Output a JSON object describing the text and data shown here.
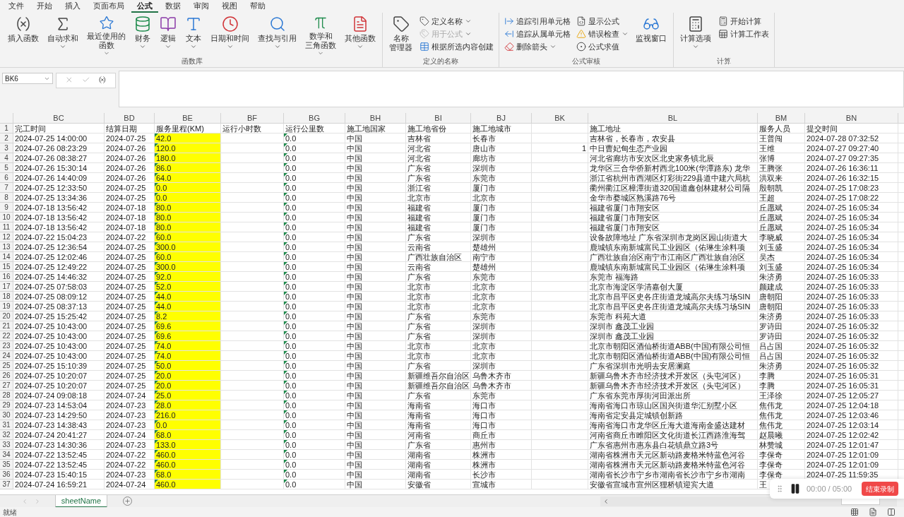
{
  "menu_tabs": [
    {
      "label": "文件",
      "selected": false
    },
    {
      "label": "开始",
      "selected": false
    },
    {
      "label": "插入",
      "selected": false
    },
    {
      "label": "页面布局",
      "selected": false
    },
    {
      "label": "公式",
      "selected": true
    },
    {
      "label": "数据",
      "selected": false
    },
    {
      "label": "审阅",
      "selected": false
    },
    {
      "label": "视图",
      "selected": false
    },
    {
      "label": "帮助",
      "selected": false
    }
  ],
  "ribbon": {
    "groups": [
      {
        "label": "函数库",
        "items": [
          {
            "kind": "large",
            "lines": [
              "插入函数"
            ],
            "dropdown": false
          },
          {
            "kind": "large",
            "lines": [
              "自动求和"
            ],
            "dropdown": true
          },
          {
            "kind": "large",
            "lines": [
              "最近使用的",
              "函数"
            ],
            "dropdown": true
          },
          {
            "kind": "large",
            "lines": [
              "财务"
            ],
            "dropdown": true
          },
          {
            "kind": "large",
            "lines": [
              "逻辑"
            ],
            "dropdown": true
          },
          {
            "kind": "large",
            "lines": [
              "文本"
            ],
            "dropdown": true
          },
          {
            "kind": "large",
            "lines": [
              "日期和时间"
            ],
            "dropdown": true
          },
          {
            "kind": "large",
            "lines": [
              "查找与引用"
            ],
            "dropdown": true
          },
          {
            "kind": "large",
            "lines": [
              "数学和",
              "三角函数"
            ],
            "dropdown": true
          },
          {
            "kind": "large",
            "lines": [
              "其他函数"
            ],
            "dropdown": true
          }
        ]
      },
      {
        "label": "定义的名称",
        "items": [
          {
            "kind": "large",
            "lines": [
              "名称",
              "管理器"
            ],
            "dropdown": false
          },
          {
            "kind": "small",
            "lines": [
              "定义名称"
            ],
            "dropdown": true,
            "disabled": false
          },
          {
            "kind": "small",
            "lines": [
              "用于公式"
            ],
            "dropdown": true,
            "disabled": true
          },
          {
            "kind": "small",
            "lines": [
              "根据所选内容创建"
            ],
            "dropdown": false,
            "disabled": false
          }
        ]
      },
      {
        "label": "公式审核",
        "items": [
          {
            "kind": "small",
            "lines": [
              "追踪引用单元格"
            ],
            "dropdown": false,
            "disabled": false
          },
          {
            "kind": "small",
            "lines": [
              "追踪从属单元格"
            ],
            "dropdown": false,
            "disabled": false
          },
          {
            "kind": "small",
            "lines": [
              "删除箭头"
            ],
            "dropdown": true,
            "disabled": false
          },
          {
            "kind": "small",
            "lines": [
              "显示公式"
            ],
            "dropdown": false,
            "disabled": false
          },
          {
            "kind": "small",
            "lines": [
              "错误检查"
            ],
            "dropdown": true,
            "disabled": false
          },
          {
            "kind": "small",
            "lines": [
              "公式求值"
            ],
            "dropdown": false,
            "disabled": false
          },
          {
            "kind": "large",
            "lines": [
              "监视窗口"
            ],
            "dropdown": false
          }
        ]
      },
      {
        "label": "计算",
        "items": [
          {
            "kind": "large",
            "lines": [
              "计算选项"
            ],
            "dropdown": true
          },
          {
            "kind": "small",
            "lines": [
              "开始计算"
            ],
            "dropdown": false,
            "disabled": false
          },
          {
            "kind": "small",
            "lines": [
              "计算工作表"
            ],
            "dropdown": false,
            "disabled": false
          }
        ]
      }
    ]
  },
  "formula_bar": {
    "name_box": "BK6"
  },
  "columns": [
    {
      "letter": "BC"
    },
    {
      "letter": "BD"
    },
    {
      "letter": "BE",
      "color": "#ffff00",
      "error_flag": true
    },
    {
      "letter": "BF"
    },
    {
      "letter": "BG",
      "error_flag": true
    },
    {
      "letter": "BH"
    },
    {
      "letter": "BI"
    },
    {
      "letter": "BJ"
    },
    {
      "letter": "BK",
      "right_aligned": true
    },
    {
      "letter": "BL"
    },
    {
      "letter": "BM"
    },
    {
      "letter": "BN"
    }
  ],
  "header_row": {
    "num": "1",
    "bc": "完工时间",
    "bd": "结算日期",
    "be": "服务里程(KM)",
    "bf": "运行小时数",
    "bg": "运行公里数",
    "bh": "施工地国家",
    "bi": "施工地省份",
    "bj": "施工地城市",
    "bl": "施工地址",
    "bm": "服务人员",
    "bn": "提交时间"
  },
  "rows": [
    {
      "num": "2",
      "bc": "2024-07-25 14:00:00",
      "bd": "2024-07-25",
      "be": "42.0",
      "bg": "0.0",
      "bh": "中国",
      "bi": "吉林省",
      "bj": "长春市",
      "bl": "吉林省，长春市，农安县",
      "bm": "王普闯",
      "bn": "2024-07-28 07:32:52"
    },
    {
      "num": "3",
      "bc": "2024-07-26 08:23:29",
      "bd": "2024-07-26",
      "be": "120.0",
      "bg": "0.0",
      "bh": "中国",
      "bi": "河北省",
      "bj": "唐山市",
      "bk": "1",
      "bl": "中日曹妃甸生态产业园",
      "bm": "王维",
      "bn": "2024-07-27 09:27:40"
    },
    {
      "num": "4",
      "bc": "2024-07-26 08:38:27",
      "bd": "2024-07-26",
      "be": "180.0",
      "bg": "0.0",
      "bh": "中国",
      "bi": "河北省",
      "bj": "廊坊市",
      "bl": "河北省廊坊市安次区北史家务镇北辰",
      "bm": "张博",
      "bn": "2024-07-27 09:27:35"
    },
    {
      "num": "5",
      "bc": "2024-07-26 15:30:14",
      "bd": "2024-07-26",
      "be": "86.0",
      "bg": "0.0",
      "bh": "中国",
      "bi": "广东省",
      "bj": "深圳市",
      "bl": "龙华区三合华侨新村西北100米(华潭路东) 龙华",
      "bm": "王腾张",
      "bn": "2024-07-26 16:36:11"
    },
    {
      "num": "6",
      "bc": "2024-07-26 14:40:09",
      "bd": "2024-07-26",
      "be": "64.0",
      "bg": "0.0",
      "bh": "中国",
      "bi": "广东省",
      "bj": "东莞市",
      "bl": "浙江省杭州市西湖区灯彩街229县道中建六局杭",
      "bm": "洪双来",
      "bn": "2024-07-26 16:32:15"
    },
    {
      "num": "7",
      "bc": "2024-07-25 12:33:50",
      "bd": "2024-07-25",
      "be": "0.0",
      "bg": "0.0",
      "bh": "中国",
      "bi": "浙江省",
      "bj": "厦门市",
      "bl": "衢州衢江区樟潭街道320国道鑫创林建材公司隔",
      "bm": "殷朝凯",
      "bn": "2024-07-25 17:08:23"
    },
    {
      "num": "8",
      "bc": "2024-07-25 13:34:36",
      "bd": "2024-07-25",
      "be": "0.0",
      "bg": "0.0",
      "bh": "中国",
      "bi": "北京市",
      "bj": "北京市",
      "bl": "金华市婺城区熟溪路76号",
      "bm": "王超",
      "bn": "2024-07-25 17:08:22"
    },
    {
      "num": "9",
      "bc": "2024-07-18 13:56:42",
      "bd": "2024-07-18",
      "be": "80.0",
      "bg": "0.0",
      "bh": "中国",
      "bi": "福建省",
      "bj": "厦门市",
      "bl": "福建省厦门市翔安区",
      "bm": "丘愿斌",
      "bn": "2024-07-25 16:05:34"
    },
    {
      "num": "10",
      "bc": "2024-07-18 13:56:42",
      "bd": "2024-07-18",
      "be": "80.0",
      "bg": "0.0",
      "bh": "中国",
      "bi": "福建省",
      "bj": "厦门市",
      "bl": "福建省厦门市翔安区",
      "bm": "丘愿斌",
      "bn": "2024-07-25 16:05:34"
    },
    {
      "num": "11",
      "bc": "2024-07-18 13:56:42",
      "bd": "2024-07-18",
      "be": "80.0",
      "bg": "0.0",
      "bh": "中国",
      "bi": "福建省",
      "bj": "厦门市",
      "bl": "福建省厦门市翔安区",
      "bm": "丘愿斌",
      "bn": "2024-07-25 16:05:34"
    },
    {
      "num": "12",
      "bc": "2024-07-22 15:04:23",
      "bd": "2024-07-22",
      "be": "60.0",
      "bg": "0.0",
      "bh": "中国",
      "bi": "广东省",
      "bj": "深圳市",
      "bl": "设备故障地址 广东省深圳市龙岗区园山街道大",
      "bm": "李晓威",
      "bn": "2024-07-25 16:05:34"
    },
    {
      "num": "13",
      "bc": "2024-07-25 12:36:54",
      "bd": "2024-07-25",
      "be": "300.0",
      "bg": "0.0",
      "bh": "中国",
      "bi": "云南省",
      "bj": "楚雄州",
      "bl": "鹿城镇东南新城富民工业园区（佑琳生涂料项",
      "bm": "刘玉盛",
      "bn": "2024-07-25 16:05:34"
    },
    {
      "num": "14",
      "bc": "2024-07-25 12:02:46",
      "bd": "2024-07-25",
      "be": "60.0",
      "bg": "0.0",
      "bh": "中国",
      "bi": "广西壮族自治区",
      "bj": "南宁市",
      "bl": "广西壮族自治区南宁市江南区广西壮族自治区",
      "bm": "吴杰",
      "bn": "2024-07-25 16:05:34"
    },
    {
      "num": "15",
      "bc": "2024-07-25 12:49:22",
      "bd": "2024-07-25",
      "be": "300.0",
      "bg": "0.0",
      "bh": "中国",
      "bi": "云南省",
      "bj": "楚雄州",
      "bl": "鹿城镇东南新城富民工业园区（佑琳生涂料项",
      "bm": "刘玉盛",
      "bn": "2024-07-25 16:05:34"
    },
    {
      "num": "16",
      "bc": "2024-07-25 14:46:32",
      "bd": "2024-07-25",
      "be": "92.0",
      "bg": "0.0",
      "bh": "中国",
      "bi": "广东省",
      "bj": "东莞市",
      "bl": "东莞市 福海路",
      "bm": "朱济勇",
      "bn": "2024-07-25 16:05:33"
    },
    {
      "num": "17",
      "bc": "2024-07-25 07:58:03",
      "bd": "2024-07-25",
      "be": "52.0",
      "bg": "0.0",
      "bh": "中国",
      "bi": "北京市",
      "bj": "北京市",
      "bl": "北京市海淀区学清嘉创大厦",
      "bm": "颜建成",
      "bn": "2024-07-25 16:05:33"
    },
    {
      "num": "18",
      "bc": "2024-07-25 08:09:12",
      "bd": "2024-07-25",
      "be": "44.0",
      "bg": "0.0",
      "bh": "中国",
      "bi": "北京市",
      "bj": "北京市",
      "bl": "北京市昌平区史各庄街道龙城高尔夫练习场SIN",
      "bm": "唐朝阳",
      "bn": "2024-07-25 16:05:33"
    },
    {
      "num": "19",
      "bc": "2024-07-25 08:37:13",
      "bd": "2024-07-25",
      "be": "44.0",
      "bg": "0.0",
      "bh": "中国",
      "bi": "北京市",
      "bj": "北京市",
      "bl": "北京市昌平区史各庄街道龙城高尔夫练习场SIN",
      "bm": "唐朝阳",
      "bn": "2024-07-25 16:05:33"
    },
    {
      "num": "20",
      "bc": "2024-07-25 15:25:42",
      "bd": "2024-07-25",
      "be": "8.2",
      "bg": "0.0",
      "bh": "中国",
      "bi": "广东省",
      "bj": "东莞市",
      "bl": "东莞市 科苑大道",
      "bm": "朱济勇",
      "bn": "2024-07-25 16:05:33"
    },
    {
      "num": "21",
      "bc": "2024-07-25 10:43:00",
      "bd": "2024-07-25",
      "be": "69.6",
      "bg": "0.0",
      "bh": "中国",
      "bi": "广东省",
      "bj": "深圳市",
      "bl": "深圳市 鑫茂工业园",
      "bm": "罗诗田",
      "bn": "2024-07-25 16:05:32"
    },
    {
      "num": "22",
      "bc": "2024-07-25 10:43:00",
      "bd": "2024-07-25",
      "be": "69.6",
      "bg": "0.0",
      "bh": "中国",
      "bi": "广东省",
      "bj": "深圳市",
      "bl": "深圳市 鑫茂工业园",
      "bm": "罗诗田",
      "bn": "2024-07-25 16:05:32"
    },
    {
      "num": "23",
      "bc": "2024-07-25 10:43:00",
      "bd": "2024-07-25",
      "be": "74.0",
      "bg": "0.0",
      "bh": "中国",
      "bi": "北京市",
      "bj": "北京市",
      "bl": "北京市朝阳区酒仙桥街道ABB(中国)有限公司恒",
      "bm": "吕占国",
      "bn": "2024-07-25 16:05:32"
    },
    {
      "num": "24",
      "bc": "2024-07-25 10:43:00",
      "bd": "2024-07-25",
      "be": "74.0",
      "bg": "0.0",
      "bh": "中国",
      "bi": "北京市",
      "bj": "北京市",
      "bl": "北京市朝阳区酒仙桥街道ABB(中国)有限公司恒",
      "bm": "吕占国",
      "bn": "2024-07-25 16:05:32"
    },
    {
      "num": "25",
      "bc": "2024-07-25 15:10:39",
      "bd": "2024-07-25",
      "be": "50.0",
      "bg": "0.0",
      "bh": "中国",
      "bi": "广东省",
      "bj": "深圳市",
      "bl": "广东省深圳市光明去安居澜庭",
      "bm": "朱济勇",
      "bn": "2024-07-25 16:05:32"
    },
    {
      "num": "26",
      "bc": "2024-07-25 10:20:07",
      "bd": "2024-07-25",
      "be": "20.0",
      "bg": "0.0",
      "bh": "中国",
      "bi": "新疆维吾尔自治区",
      "bj": "乌鲁木齐市",
      "bl": "新疆乌鲁木齐市经济技术开发区（头屯河区）",
      "bm": "李腾",
      "bn": "2024-07-25 16:05:31"
    },
    {
      "num": "27",
      "bc": "2024-07-25 10:20:07",
      "bd": "2024-07-25",
      "be": "20.0",
      "bg": "0.0",
      "bh": "中国",
      "bi": "新疆维吾尔自治区",
      "bj": "乌鲁木齐市",
      "bl": "新疆乌鲁木齐市经济技术开发区（头屯河区）",
      "bm": "李腾",
      "bn": "2024-07-25 16:05:31"
    },
    {
      "num": "28",
      "bc": "2024-07-24 09:08:18",
      "bd": "2024-07-24",
      "be": "25.0",
      "bg": "0.0",
      "bh": "中国",
      "bi": "广东省",
      "bj": "东莞市",
      "bl": "广东省东莞市厚街河田派出所",
      "bm": "王泽徐",
      "bn": "2024-07-25 12:05:27"
    },
    {
      "num": "29",
      "bc": "2024-07-23 14:53:04",
      "bd": "2024-07-23",
      "be": "28.0",
      "bg": "0.0",
      "bh": "中国",
      "bi": "海南省",
      "bj": "海口市",
      "bl": "海南省海口市琼山区国兴街道华汇别墅小区",
      "bm": "焦伟龙",
      "bn": "2024-07-25 12:04:18"
    },
    {
      "num": "30",
      "bc": "2024-07-23 14:29:50",
      "bd": "2024-07-23",
      "be": "216.0",
      "bg": "0.0",
      "bh": "中国",
      "bi": "海南省",
      "bj": "海口市",
      "bl": "海南省定安县定城镇创新路",
      "bm": "焦伟龙",
      "bn": "2024-07-25 12:03:46"
    },
    {
      "num": "31",
      "bc": "2024-07-23 14:38:43",
      "bd": "2024-07-23",
      "be": "0.0",
      "bg": "0.0",
      "bh": "中国",
      "bi": "海南省",
      "bj": "海口市",
      "bl": "海南省海口市龙华区丘海大道海南金盛达建材",
      "bm": "焦伟龙",
      "bn": "2024-07-25 12:03:14"
    },
    {
      "num": "32",
      "bc": "2024-07-24 20:41:27",
      "bd": "2024-07-24",
      "be": "68.0",
      "bg": "0.0",
      "bh": "中国",
      "bi": "河南省",
      "bj": "商丘市",
      "bl": "河南省商丘市睢阳区文化街道长江西路淮海驾",
      "bm": "赵晨曦",
      "bn": "2024-07-25 12:02:42"
    },
    {
      "num": "33",
      "bc": "2024-07-23 14:30:36",
      "bd": "2024-07-23",
      "be": "133.0",
      "bg": "0.0",
      "bh": "中国",
      "bi": "广东省",
      "bj": "惠州市",
      "bl": "广东省惠州市惠东县白花镇鼎立路3号",
      "bm": "林赞城",
      "bn": "2024-07-25 12:01:47"
    },
    {
      "num": "34",
      "bc": "2024-07-22 13:52:45",
      "bd": "2024-07-22",
      "be": "460.0",
      "bg": "0.0",
      "bh": "中国",
      "bi": "湖南省",
      "bj": "株洲市",
      "bl": "湖南省株洲市天元区新动路麦格米特蓝色河谷",
      "bm": "李保奇",
      "bn": "2024-07-25 12:01:09"
    },
    {
      "num": "35",
      "bc": "2024-07-22 13:52:45",
      "bd": "2024-07-22",
      "be": "460.0",
      "bg": "0.0",
      "bh": "中国",
      "bi": "湖南省",
      "bj": "株洲市",
      "bl": "湖南省株洲市天元区新动路麦格米特蓝色河谷",
      "bm": "李保奇",
      "bn": "2024-07-25 12:01:09"
    },
    {
      "num": "36",
      "bc": "2024-07-23 15:40:15",
      "bd": "2024-07-23",
      "be": "68.0",
      "bg": "0.0",
      "bh": "中国",
      "bi": "湖南省",
      "bj": "长沙市",
      "bl": "湖南省长沙市宁乡市湖南省长沙市宁乡市湖南",
      "bm": "李保奇",
      "bn": "2024-07-25 11:59:35"
    },
    {
      "num": "37",
      "bc": "2024-07-24 16:59:21",
      "bd": "2024-07-24",
      "be": "460.0",
      "bg": "0.0",
      "bh": "中国",
      "bi": "安徽省",
      "bj": "宣城市",
      "bl": "安徽省宣城市宣州区狸桥镇迎宾大道",
      "bm": "王"
    }
  ],
  "sheets": [
    {
      "name": "sheetName",
      "selected": true
    }
  ],
  "status": "就绪",
  "recorder": {
    "time": "00:00 / 05:00",
    "button": "结束录制"
  }
}
